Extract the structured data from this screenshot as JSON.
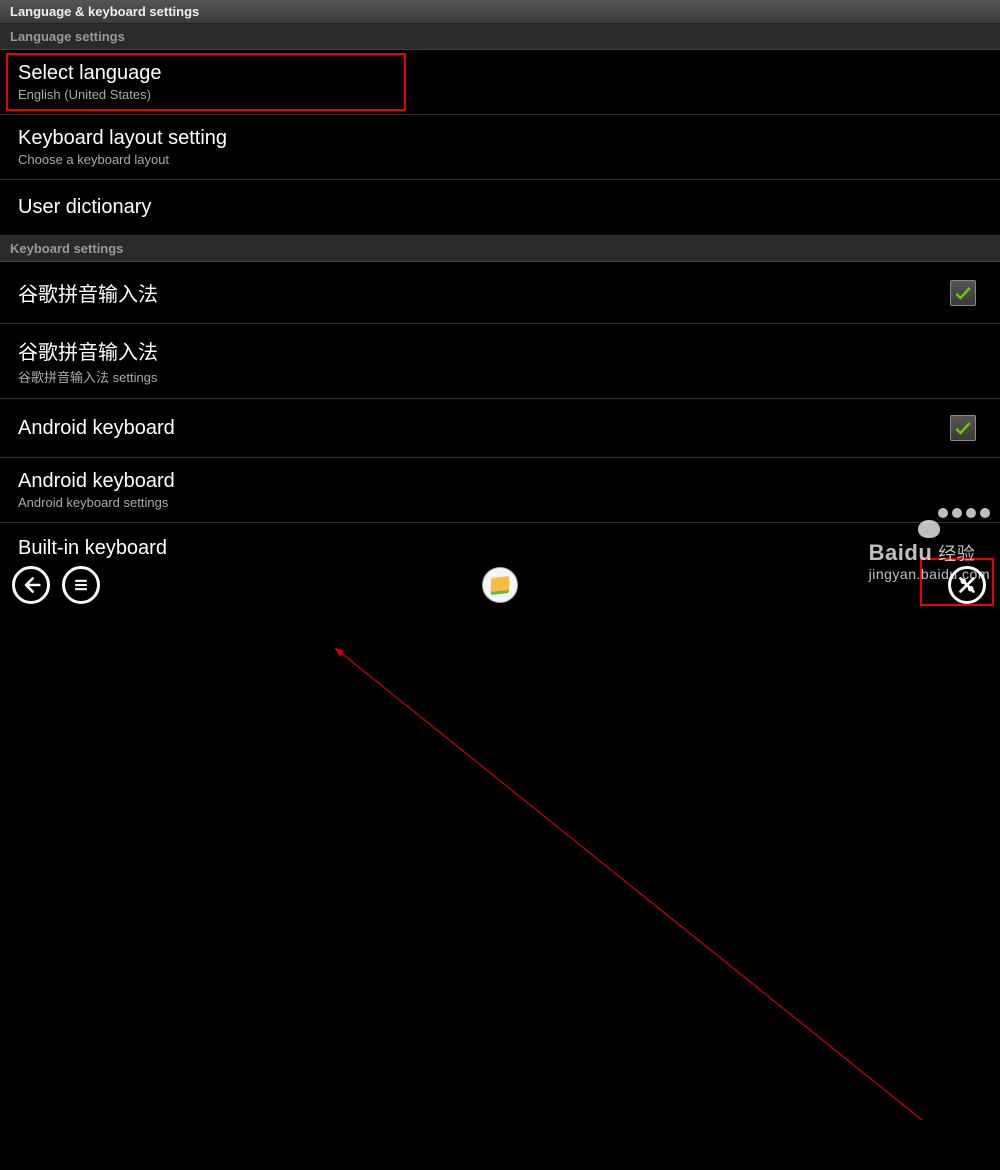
{
  "titleBar": "Language & keyboard settings",
  "section1": {
    "header": "Language settings",
    "items": [
      {
        "primary": "Select language",
        "secondary": "English (United States)"
      },
      {
        "primary": "Keyboard layout setting",
        "secondary": "Choose a keyboard layout"
      },
      {
        "primary": "User dictionary"
      }
    ]
  },
  "section2": {
    "header": "Keyboard settings",
    "items": [
      {
        "primary": "谷歌拼音输入法",
        "checked": true
      },
      {
        "primary": "谷歌拼音输入法",
        "secondary": "谷歌拼音输入法 settings"
      },
      {
        "primary": "Android keyboard",
        "checked": true
      },
      {
        "primary": "Android keyboard",
        "secondary": "Android keyboard settings"
      },
      {
        "primary": "Built-in keyboard"
      }
    ]
  },
  "watermark": {
    "brand": "Baidu",
    "cn": "经验",
    "url": "jingyan.baidu.com"
  }
}
